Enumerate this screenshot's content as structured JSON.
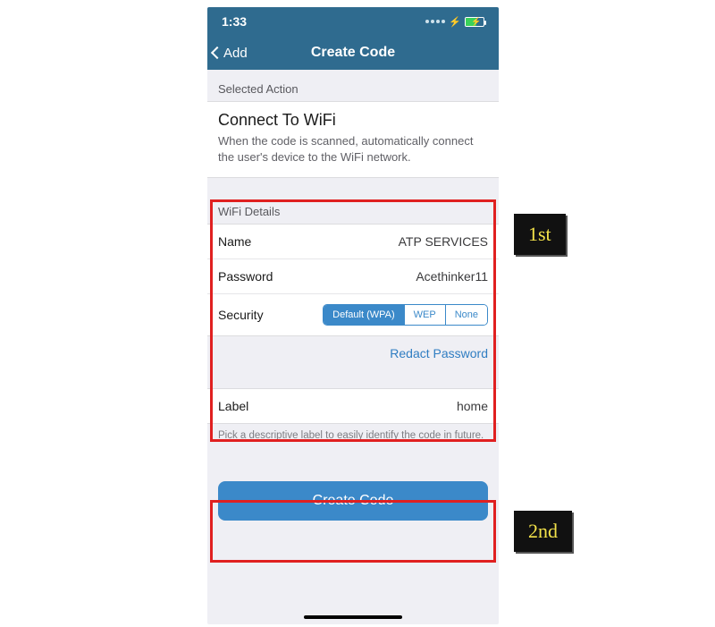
{
  "status": {
    "time": "1:33"
  },
  "nav": {
    "back_label": "Add",
    "title": "Create Code"
  },
  "selected_action": {
    "header": "Selected Action",
    "title": "Connect To WiFi",
    "description": "When the code is scanned, automatically connect the user's device to the WiFi network."
  },
  "wifi_details": {
    "header": "WiFi Details",
    "rows": {
      "name": {
        "label": "Name",
        "value": "ATP SERVICES"
      },
      "password": {
        "label": "Password",
        "value": "Acethinker11"
      },
      "security": {
        "label": "Security"
      }
    },
    "security_options": {
      "default_wpa": "Default (WPA)",
      "wep": "WEP",
      "none": "None"
    },
    "redact_label": "Redact Password",
    "label_row": {
      "label": "Label",
      "value": "home"
    },
    "footer": "Pick a descriptive label to easily identify the code in future."
  },
  "create_button": "Create Code",
  "annotations": {
    "first": "1st",
    "second": "2nd"
  }
}
